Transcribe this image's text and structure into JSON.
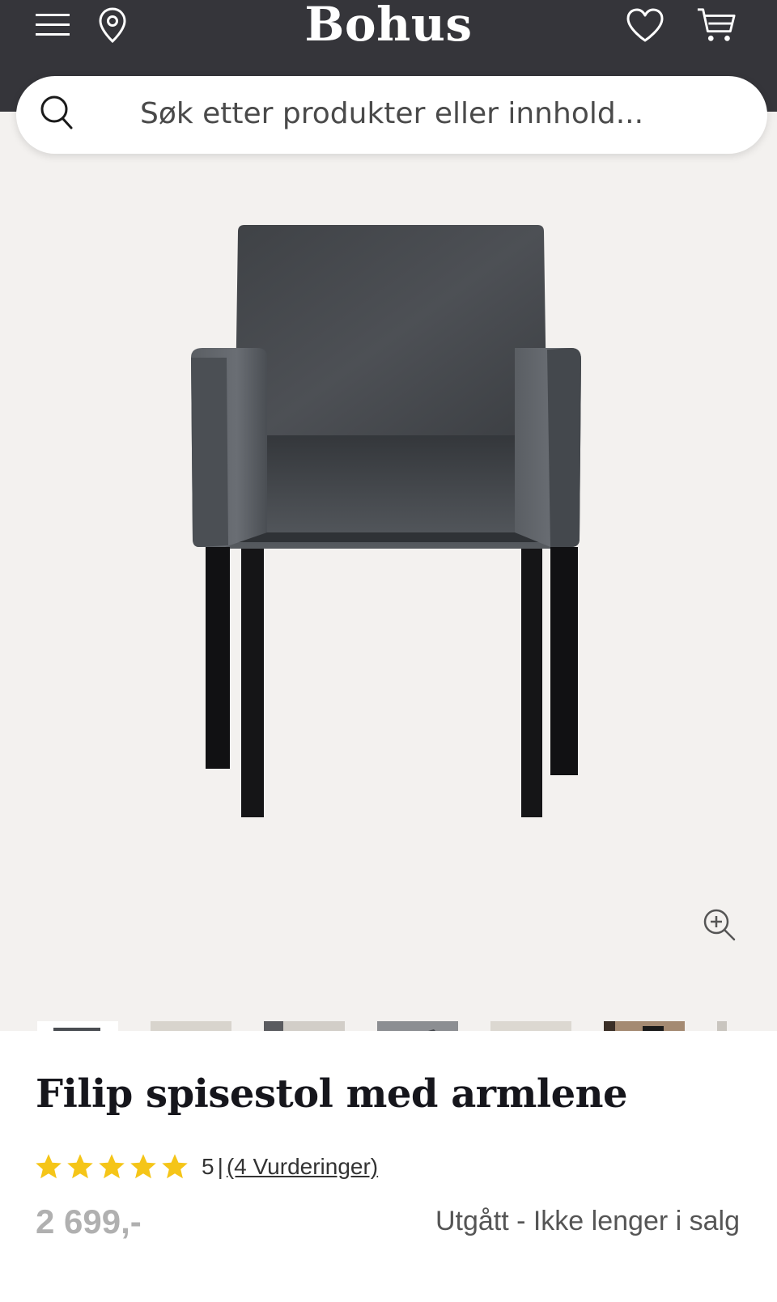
{
  "header": {
    "logo": "Bohus",
    "menu_icon": "hamburger-menu-icon",
    "location_icon": "map-pin-icon",
    "wishlist_icon": "heart-icon",
    "cart_icon": "shopping-cart-icon",
    "background": "#35353a"
  },
  "search": {
    "placeholder": "Søk etter produkter eller innhold...",
    "icon": "search-icon"
  },
  "gallery": {
    "zoom_icon": "zoom-in-icon",
    "background": "#f3f1ef",
    "thumbnails": [
      {
        "alt": "chair-front"
      },
      {
        "alt": "dining-room-1"
      },
      {
        "alt": "dining-room-2"
      },
      {
        "alt": "chair-detail"
      },
      {
        "alt": "dining-room-3"
      },
      {
        "alt": "dining-room-4"
      },
      {
        "alt": "partial"
      }
    ]
  },
  "product": {
    "title": "Filip spisestol med armlene",
    "rating": {
      "stars": 5,
      "score": "5",
      "separator": "|",
      "reviews_link": "(4 Vurderinger)",
      "star_color": "#f5c518"
    },
    "price": "2 699,-",
    "status": "Utgått - Ikke lenger i salg"
  }
}
